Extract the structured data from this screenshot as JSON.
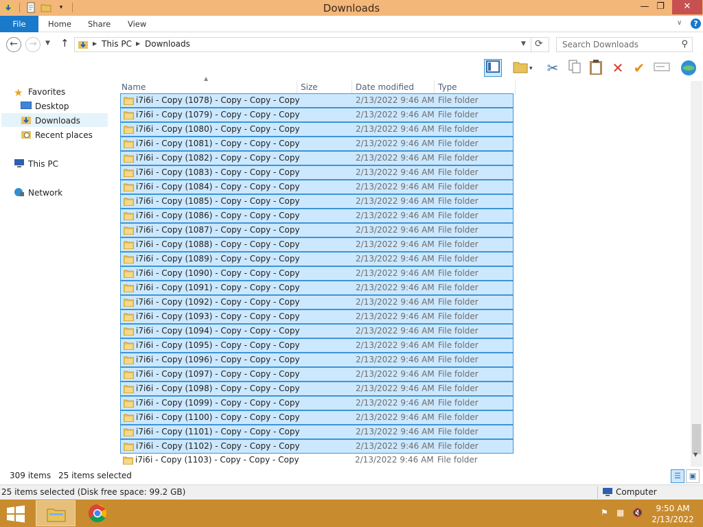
{
  "window": {
    "title": "Downloads",
    "min_glyph": "—",
    "max_glyph": "❐",
    "close_glyph": "✕"
  },
  "ribbon": {
    "tabs": [
      "File",
      "Home",
      "Share",
      "View"
    ],
    "help": "?"
  },
  "address": {
    "segments": [
      "This PC",
      "Downloads"
    ]
  },
  "search": {
    "placeholder": "Search Downloads"
  },
  "navpane": {
    "favorites": "Favorites",
    "desktop": "Desktop",
    "downloads": "Downloads",
    "recent": "Recent places",
    "thispc": "This PC",
    "network": "Network"
  },
  "columns": {
    "name": "Name",
    "size": "Size",
    "date": "Date modified",
    "type": "Type"
  },
  "files": [
    {
      "name": "i7i6i - Copy (1078) - Copy - Copy - Copy",
      "date": "2/13/2022 9:46 AM",
      "type": "File folder",
      "selected": true
    },
    {
      "name": "i7i6i - Copy (1079) - Copy - Copy - Copy",
      "date": "2/13/2022 9:46 AM",
      "type": "File folder",
      "selected": true
    },
    {
      "name": "i7i6i - Copy (1080) - Copy - Copy - Copy",
      "date": "2/13/2022 9:46 AM",
      "type": "File folder",
      "selected": true
    },
    {
      "name": "i7i6i - Copy (1081) - Copy - Copy - Copy",
      "date": "2/13/2022 9:46 AM",
      "type": "File folder",
      "selected": true
    },
    {
      "name": "i7i6i - Copy (1082) - Copy - Copy - Copy",
      "date": "2/13/2022 9:46 AM",
      "type": "File folder",
      "selected": true
    },
    {
      "name": "i7i6i - Copy (1083) - Copy - Copy - Copy",
      "date": "2/13/2022 9:46 AM",
      "type": "File folder",
      "selected": true
    },
    {
      "name": "i7i6i - Copy (1084) - Copy - Copy - Copy",
      "date": "2/13/2022 9:46 AM",
      "type": "File folder",
      "selected": true
    },
    {
      "name": "i7i6i - Copy (1085) - Copy - Copy - Copy",
      "date": "2/13/2022 9:46 AM",
      "type": "File folder",
      "selected": true
    },
    {
      "name": "i7i6i - Copy (1086) - Copy - Copy - Copy",
      "date": "2/13/2022 9:46 AM",
      "type": "File folder",
      "selected": true
    },
    {
      "name": "i7i6i - Copy (1087) - Copy - Copy - Copy",
      "date": "2/13/2022 9:46 AM",
      "type": "File folder",
      "selected": true
    },
    {
      "name": "i7i6i - Copy (1088) - Copy - Copy - Copy",
      "date": "2/13/2022 9:46 AM",
      "type": "File folder",
      "selected": true
    },
    {
      "name": "i7i6i - Copy (1089) - Copy - Copy - Copy",
      "date": "2/13/2022 9:46 AM",
      "type": "File folder",
      "selected": true
    },
    {
      "name": "i7i6i - Copy (1090) - Copy - Copy - Copy",
      "date": "2/13/2022 9:46 AM",
      "type": "File folder",
      "selected": true
    },
    {
      "name": "i7i6i - Copy (1091) - Copy - Copy - Copy",
      "date": "2/13/2022 9:46 AM",
      "type": "File folder",
      "selected": true
    },
    {
      "name": "i7i6i - Copy (1092) - Copy - Copy - Copy",
      "date": "2/13/2022 9:46 AM",
      "type": "File folder",
      "selected": true
    },
    {
      "name": "i7i6i - Copy (1093) - Copy - Copy - Copy",
      "date": "2/13/2022 9:46 AM",
      "type": "File folder",
      "selected": true
    },
    {
      "name": "i7i6i - Copy (1094) - Copy - Copy - Copy",
      "date": "2/13/2022 9:46 AM",
      "type": "File folder",
      "selected": true
    },
    {
      "name": "i7i6i - Copy (1095) - Copy - Copy - Copy",
      "date": "2/13/2022 9:46 AM",
      "type": "File folder",
      "selected": true
    },
    {
      "name": "i7i6i - Copy (1096) - Copy - Copy - Copy",
      "date": "2/13/2022 9:46 AM",
      "type": "File folder",
      "selected": true
    },
    {
      "name": "i7i6i - Copy (1097) - Copy - Copy - Copy",
      "date": "2/13/2022 9:46 AM",
      "type": "File folder",
      "selected": true
    },
    {
      "name": "i7i6i - Copy (1098) - Copy - Copy - Copy",
      "date": "2/13/2022 9:46 AM",
      "type": "File folder",
      "selected": true
    },
    {
      "name": "i7i6i - Copy (1099) - Copy - Copy - Copy",
      "date": "2/13/2022 9:46 AM",
      "type": "File folder",
      "selected": true
    },
    {
      "name": "i7i6i - Copy (1100) - Copy - Copy - Copy",
      "date": "2/13/2022 9:46 AM",
      "type": "File folder",
      "selected": true
    },
    {
      "name": "i7i6i - Copy (1101) - Copy - Copy - Copy",
      "date": "2/13/2022 9:46 AM",
      "type": "File folder",
      "selected": true
    },
    {
      "name": "i7i6i - Copy (1102) - Copy - Copy - Copy",
      "date": "2/13/2022 9:46 AM",
      "type": "File folder",
      "selected": true
    },
    {
      "name": "i7i6i - Copy (1103) - Copy - Copy - Copy",
      "date": "2/13/2022 9:46 AM",
      "type": "File folder",
      "selected": false
    }
  ],
  "status": {
    "count": "309 items",
    "selected": "25 items selected",
    "disk": "25 items selected (Disk free space: 99.2 GB)",
    "location": "Computer"
  },
  "taskbar": {
    "time": "9:50 AM",
    "date": "2/13/2022"
  },
  "colors": {
    "titlebar": "#f3b77a",
    "accent": "#1979ca",
    "selection": "#cce8ff",
    "selection_border": "#3d94d4",
    "taskbar": "#c88b2e"
  },
  "icons": {
    "toolbar": [
      "preview-pane-icon",
      "new-folder-icon",
      "cut-icon",
      "copy-icon",
      "paste-icon",
      "delete-icon",
      "check-icon",
      "rename-icon",
      "globe-icon"
    ]
  }
}
